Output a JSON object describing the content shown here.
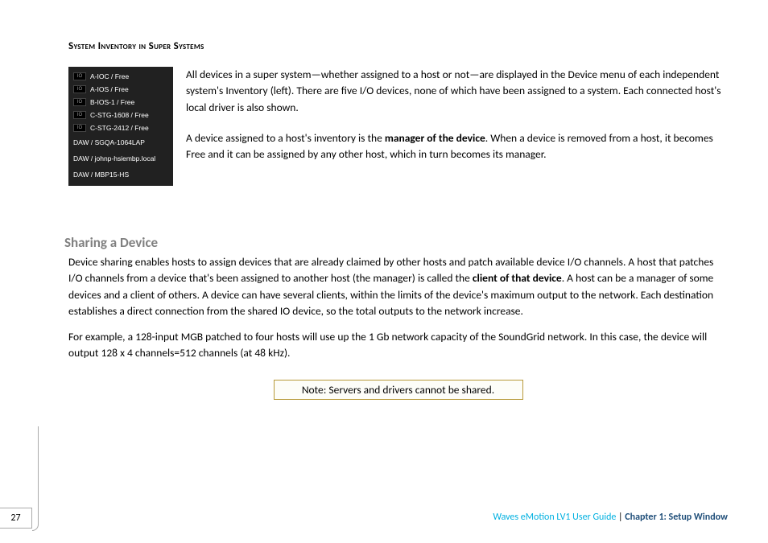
{
  "sectionHeading1": "System Inventory in Super Systems",
  "deviceMenu": {
    "row0": "A-IOC / Free",
    "row1": "A-IOS / Free",
    "row2": "B-IOS-1 / Free",
    "row3": "C-STG-1608 / Free",
    "row4": "C-STG-2412 / Free",
    "row5": "DAW / SGQA-1064LAP",
    "row6": "DAW / johnp-hsiembp.local",
    "row7": "DAW / MBP15-HS",
    "ioLabel": "IO"
  },
  "topText": {
    "p1": "All devices in a super system—whether assigned to a host or not—are displayed in the Device menu of each independent system's Inventory (left). There are five I/O devices, none of which have been assigned to a system. Each connected host's local driver is also shown.",
    "p2a": "A device assigned to a host's inventory is the ",
    "p2bold": "manager of the device",
    "p2b": ". When a device is removed from a host, it becomes Free and it can be assigned by any other host, which in turn becomes its manager."
  },
  "sectionHeading2": "Sharing a Device",
  "bodyText": {
    "p1a": "Device sharing enables hosts to assign devices that are already claimed by other hosts and patch available device I/O channels. A host that patches I/O channels from a device that's been assigned to another host (the manager) is called the ",
    "p1bold": "client of that device",
    "p1b": ". A host can be a manager of some devices and a client of others. A device can have several clients, within the limits of the device's maximum output to the network. Each destination establishes a direct connection from the shared IO device, so the total outputs to the network increase.",
    "p2": "For example, a 128-input MGB patched to four hosts will use up the 1 Gb network capacity of the SoundGrid network. In this case, the device will output 128 x 4 channels=512 channels (at 48 kHz)."
  },
  "noteText": "Note: Servers and drivers cannot be shared.",
  "footer": {
    "title": "Waves eMotion LV1 User Guide",
    "chapter": "Chapter 1: Setup Window",
    "pipe": " | "
  },
  "pageNumber": "27"
}
